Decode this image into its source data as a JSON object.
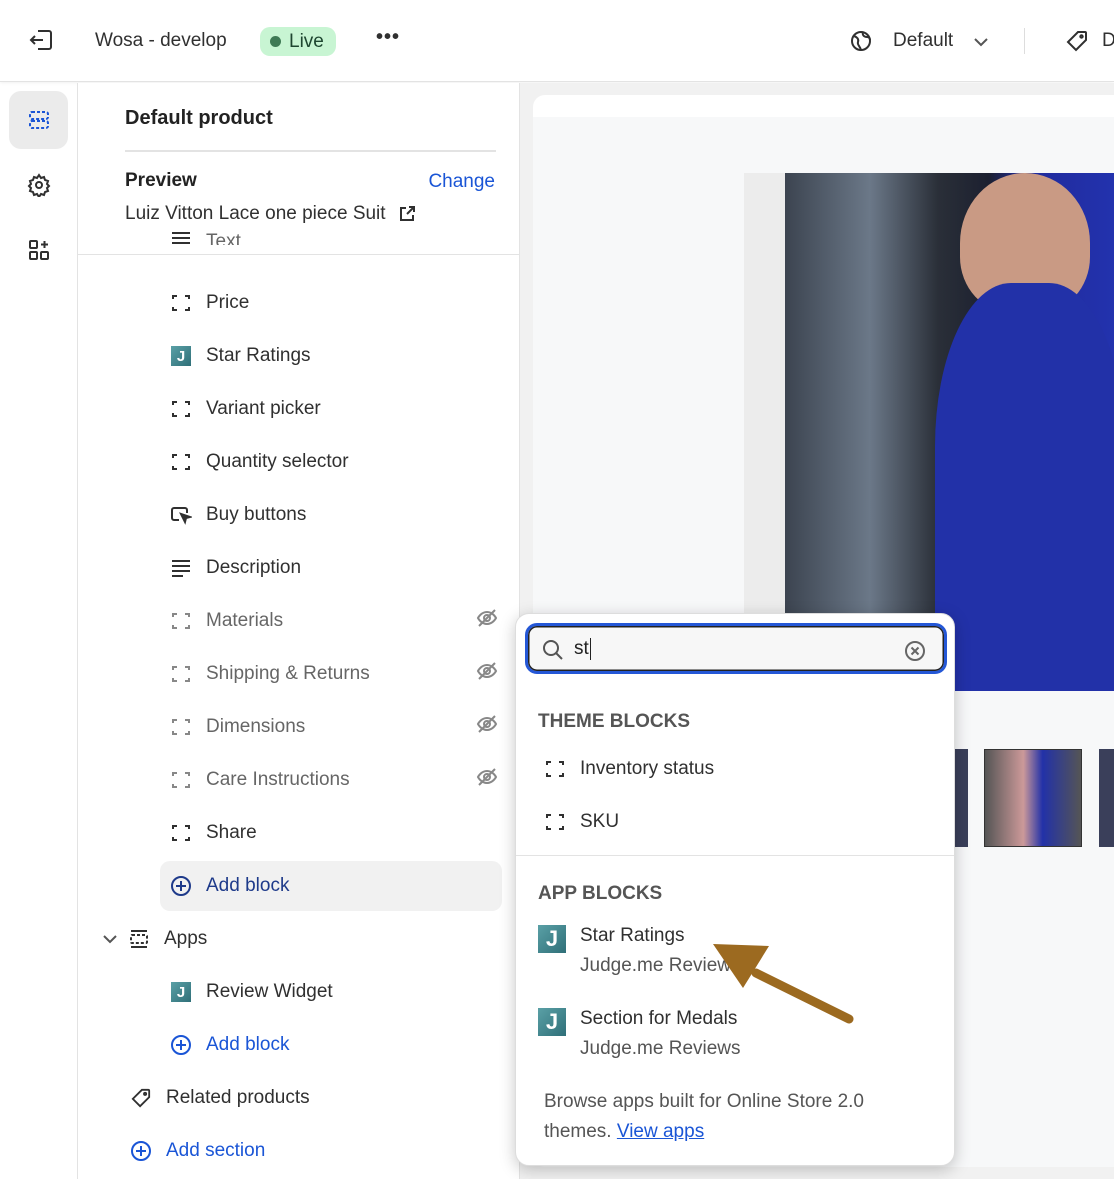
{
  "topbar": {
    "store_name": "Wosa - develop",
    "status": "Live",
    "more": "•••",
    "language": "Default",
    "right_label": "D"
  },
  "panel": {
    "title": "Default product",
    "preview_label": "Preview",
    "change_link": "Change",
    "product_name": "Luiz Vitton Lace one piece Suit",
    "cut_item": "Text",
    "blocks": [
      {
        "label": "Price",
        "icon": "block-icon",
        "hidden": false
      },
      {
        "label": "Star Ratings",
        "icon": "judgeme-icon",
        "hidden": false
      },
      {
        "label": "Variant picker",
        "icon": "block-icon",
        "hidden": false
      },
      {
        "label": "Quantity selector",
        "icon": "block-icon",
        "hidden": false
      },
      {
        "label": "Buy buttons",
        "icon": "cursor-click-icon",
        "hidden": false
      },
      {
        "label": "Description",
        "icon": "text-lines-icon",
        "hidden": false
      },
      {
        "label": "Materials",
        "icon": "block-icon",
        "hidden": true
      },
      {
        "label": "Shipping & Returns",
        "icon": "block-icon",
        "hidden": true
      },
      {
        "label": "Dimensions",
        "icon": "block-icon",
        "hidden": true
      },
      {
        "label": "Care Instructions",
        "icon": "block-icon",
        "hidden": true
      },
      {
        "label": "Share",
        "icon": "block-icon",
        "hidden": false
      }
    ],
    "add_block": "Add block",
    "apps_label": "Apps",
    "review_widget": "Review Widget",
    "apps_add_block": "Add block",
    "related_products": "Related products",
    "add_section": "Add section"
  },
  "popover": {
    "search_value": "st",
    "theme_blocks_title": "THEME BLOCKS",
    "theme_blocks": [
      "Inventory status",
      "SKU"
    ],
    "app_blocks_title": "APP BLOCKS",
    "app_blocks": [
      {
        "name": "Star Ratings",
        "app": "Judge.me Reviews"
      },
      {
        "name": "Section for Medals",
        "app": "Judge.me Reviews"
      }
    ],
    "footer_text": "Browse apps built for Online Store 2.0 themes.",
    "footer_link": "View apps"
  },
  "colors": {
    "accent": "#1a55d6",
    "live_badge": "#c8f5d3",
    "focus": "#2457d6",
    "arrow": "#9c6a20"
  }
}
